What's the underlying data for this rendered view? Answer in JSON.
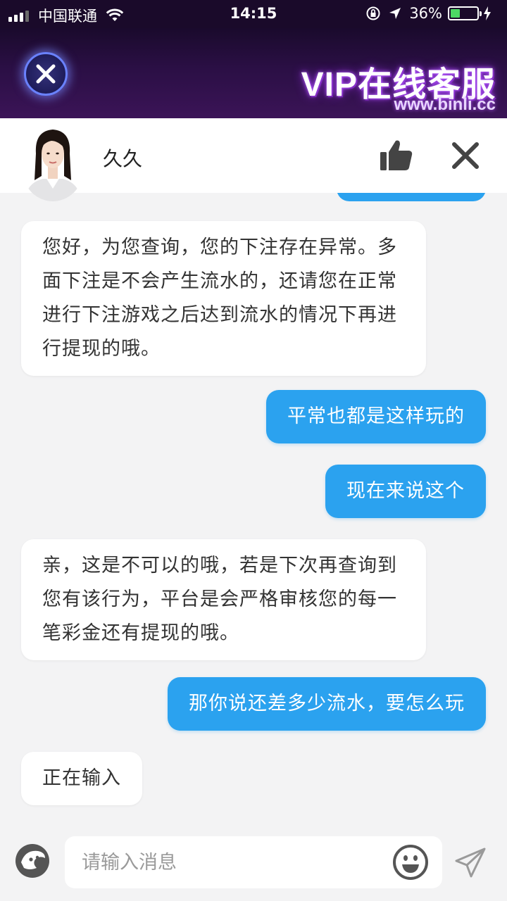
{
  "status_bar": {
    "carrier": "中国联通",
    "time": "14:15",
    "battery_percent": "36%",
    "battery_level": 0.36,
    "icons": [
      "signal-icon",
      "wifi-icon",
      "orientation-lock-icon",
      "location-arrow-icon",
      "battery-icon",
      "charging-icon"
    ]
  },
  "banner": {
    "title": "VIP在线客服",
    "url": "www.binli.cc",
    "close_icon": "close-icon"
  },
  "chat_header": {
    "agent_name": "久久",
    "avatar": "agent-avatar",
    "like_icon": "thumbs-up-icon",
    "close_icon": "close-icon"
  },
  "messages": [
    {
      "sender": "agent",
      "text": "您好，为您查询，您的下注存在异常。多面下注是不会产生流水的，还请您在正常进行下注游戏之后达到流水的情况下再进行提现的哦。"
    },
    {
      "sender": "user",
      "text": "平常也都是这样玩的"
    },
    {
      "sender": "user",
      "text": "现在来说这个"
    },
    {
      "sender": "agent",
      "text": "亲，这是不可以的哦，若是下次再查询到您有该行为，平台是会严格审核您的每一笔彩金还有提现的哦。"
    },
    {
      "sender": "user",
      "text": "那你说还差多少流水，要怎么玩"
    },
    {
      "sender": "agent",
      "text": "正在输入"
    }
  ],
  "input_bar": {
    "placeholder": "请输入消息",
    "value": "",
    "icons": [
      "voice-icon",
      "emoji-icon",
      "send-icon"
    ]
  },
  "colors": {
    "user_bubble": "#2ba2ef",
    "agent_bubble": "#ffffff",
    "chat_background": "#f3f3f4",
    "banner_top": "#1a0a2c",
    "banner_bottom": "#3b1457",
    "battery_fill": "#4cd964"
  }
}
